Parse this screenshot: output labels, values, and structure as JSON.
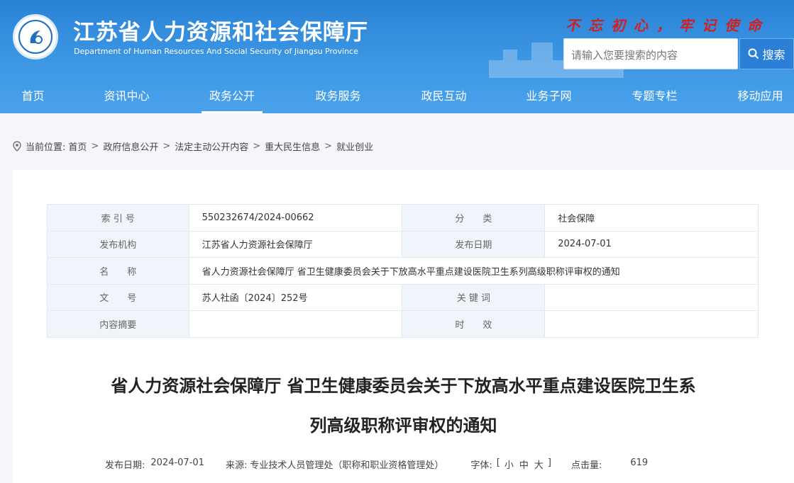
{
  "header": {
    "title": "江苏省人力资源和社会保障厅",
    "subtitle": "Department of Human Resources And Social Security of Jiangsu Province",
    "slogan": "不忘初心，牢记使命",
    "search_placeholder": "请输入您要搜索的内容",
    "search_button": "搜索",
    "accent_color": "#2a82d6",
    "slogan_color": "#d41f1f"
  },
  "nav": {
    "items": [
      "首页",
      "资讯中心",
      "政务公开",
      "政务服务",
      "政民互动",
      "业务子网",
      "专题专栏",
      "移动应用"
    ],
    "active": "政务公开"
  },
  "breadcrumb": {
    "prefix": "当前位置:",
    "items": [
      "首页",
      "政府信息公开",
      "法定主动公开内容",
      "重大民生信息",
      "就业创业"
    ]
  },
  "meta": {
    "index_label": "索 引 号",
    "index_value": "550232674/2024-00662",
    "category_label": "分　　类",
    "category_value": "社会保障",
    "publisher_label": "发布机构",
    "publisher_value": "江苏省人力资源社会保障厅",
    "date_label": "发布日期",
    "date_value": "2024-07-01",
    "name_label": "名　　称",
    "name_value": "省人力资源社会保障厅 省卫生健康委员会关于下放高水平重点建设医院卫生系列高级职称评审权的通知",
    "docno_label": "文　　号",
    "docno_value": "苏人社函〔2024〕252号",
    "keywords_label": "关 键 词",
    "keywords_value": "",
    "summary_label": "内容摘要",
    "summary_value": "",
    "validity_label": "时　　效",
    "validity_value": ""
  },
  "document": {
    "title_line1": "省人力资源社会保障厅 省卫生健康委员会关于下放高水平重点建设医院卫生系",
    "title_line2": "列高级职称评审权的通知",
    "date_label": "发布日期:",
    "date": "2024-07-01",
    "source_label": "来源:",
    "source": "专业技术人员管理处（职称和职业资格管理处）",
    "font_label": "字体:",
    "font_open": "[",
    "font_small": "小",
    "font_medium": "中",
    "font_large": "大",
    "font_close": "]",
    "hits_label": "点击量:",
    "hits": "619"
  }
}
